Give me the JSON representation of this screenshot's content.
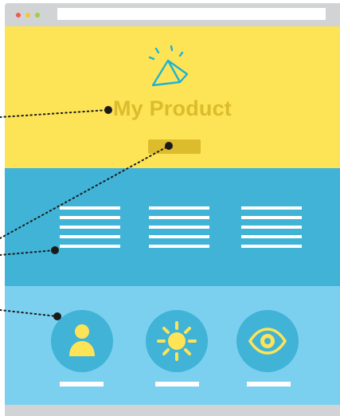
{
  "hero": {
    "title": "My Product"
  },
  "icons": {
    "items": [
      "person-icon",
      "sun-icon",
      "eye-icon"
    ]
  },
  "colors": {
    "hero_bg": "#fde457",
    "accent": "#dcbb2c",
    "features_bg": "#40b3d7",
    "icons_bg": "#7bd0ef",
    "logo": "#1fb3d1"
  }
}
